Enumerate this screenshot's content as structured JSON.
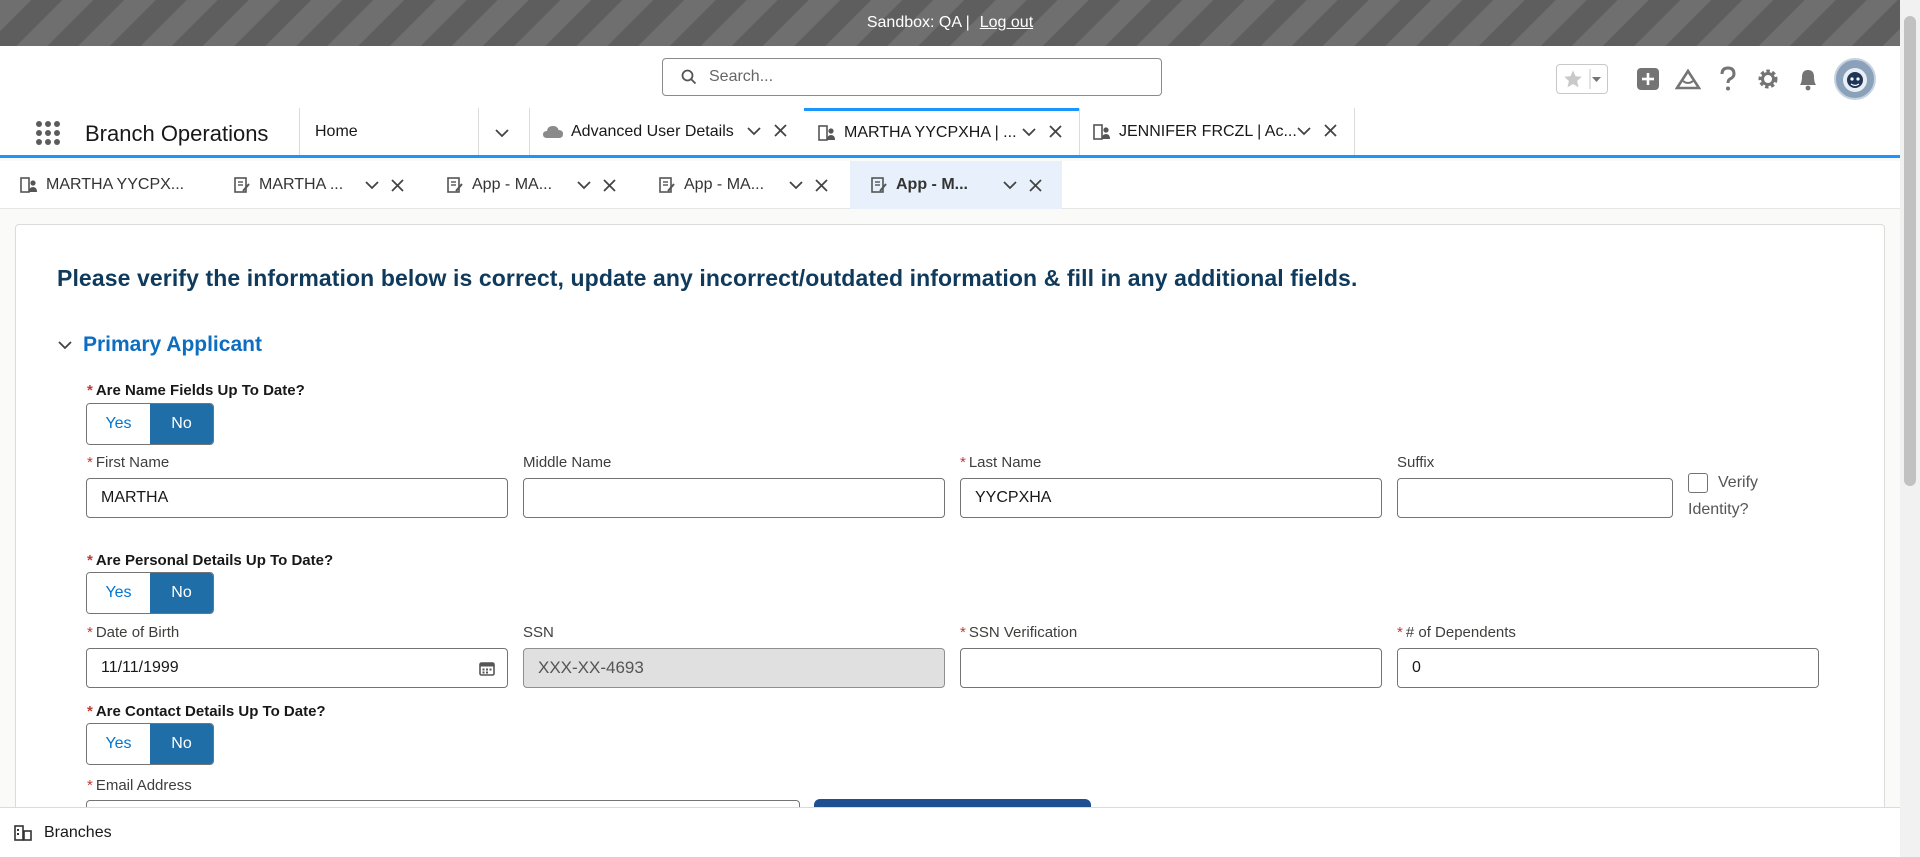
{
  "sandbox": {
    "label": "Sandbox: QA |",
    "logout": "Log out"
  },
  "header": {
    "search_placeholder": "Search...",
    "icons": [
      "favorites-star-icon",
      "global-actions-plus-icon",
      "trailhead-icon",
      "help-icon",
      "setup-gear-icon",
      "notifications-bell-icon",
      "user-avatar"
    ]
  },
  "nav": {
    "app_name": "Branch Operations",
    "home": "Home",
    "tabs": [
      {
        "label": "Advanced User Details",
        "icon": "cloud-icon"
      },
      {
        "label": "MARTHA YYCPXHA | ...",
        "icon": "person-account-icon",
        "active": true
      },
      {
        "label": "JENNIFER FRCZL | Ac...",
        "icon": "person-account-icon"
      }
    ]
  },
  "subtabs": [
    {
      "label": "MARTHA YYCPX...",
      "icon": "person-account-icon"
    },
    {
      "label": "MARTHA ...",
      "icon": "application-icon"
    },
    {
      "label": "App - MA...",
      "icon": "application-icon"
    },
    {
      "label": "App - MA...",
      "icon": "application-icon"
    },
    {
      "label": "App - M...",
      "icon": "application-icon",
      "active": true
    }
  ],
  "form": {
    "title": "Please verify the information below is correct, update any incorrect/outdated information & fill in any additional fields.",
    "section": "Primary Applicant",
    "q_name": "Are Name Fields Up To Date?",
    "q_personal": "Are Personal Details Up To Date?",
    "q_contact": "Are Contact Details Up To Date?",
    "yes": "Yes",
    "no": "No",
    "first_name": {
      "label": "First Name",
      "value": "MARTHA"
    },
    "middle_name": {
      "label": "Middle Name",
      "value": ""
    },
    "last_name": {
      "label": "Last Name",
      "value": "YYCPXHA"
    },
    "suffix": {
      "label": "Suffix",
      "value": ""
    },
    "verify_identity": "Verify Identity?",
    "dob": {
      "label": "Date of Birth",
      "value": "11/11/1999"
    },
    "ssn": {
      "label": "SSN",
      "value": "XXX-XX-4693"
    },
    "ssn_verification": {
      "label": "SSN Verification",
      "value": ""
    },
    "dependents": {
      "label": "# of Dependents",
      "value": "0"
    },
    "email": {
      "label": "Email Address"
    }
  },
  "utility": {
    "label": "Branches"
  },
  "colors": {
    "accent": "#1b96ff",
    "selected_toggle": "#1f6ea8",
    "title": "#0f3a5c",
    "section": "#0d6dc0",
    "required": "#c23934"
  }
}
